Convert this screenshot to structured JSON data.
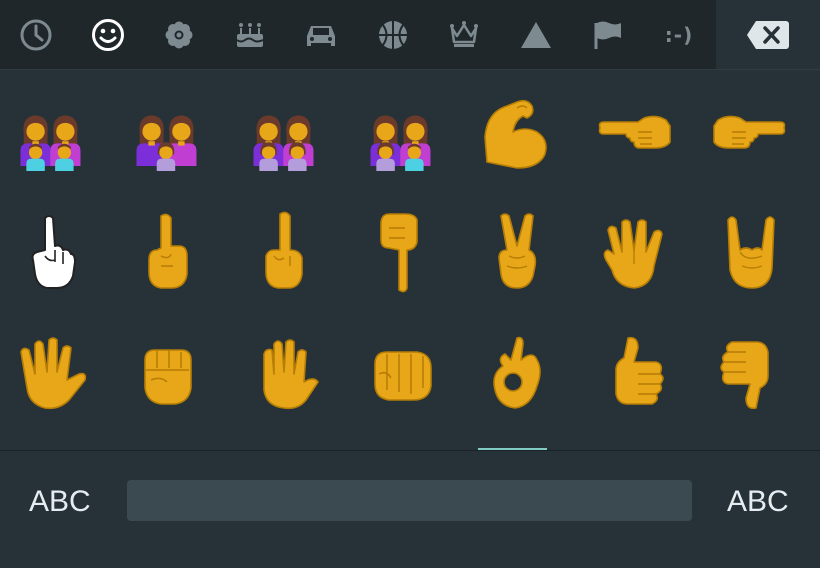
{
  "emoji_tabs": [
    {
      "icon": "clock-icon",
      "active": false
    },
    {
      "icon": "smiley-icon",
      "active": true
    },
    {
      "icon": "flower-icon",
      "active": false
    },
    {
      "icon": "cake-icon",
      "active": false
    },
    {
      "icon": "car-icon",
      "active": false
    },
    {
      "icon": "basketball-icon",
      "active": false
    },
    {
      "icon": "crown-icon",
      "active": false
    },
    {
      "icon": "triangle-icon",
      "active": false
    },
    {
      "icon": "flag-icon",
      "active": false
    },
    {
      "icon": "emoticon-tab",
      "label": ":-)",
      "active": false
    }
  ],
  "delete_key": {
    "icon": "backspace-icon"
  },
  "emoji_grid": [
    [
      "family-two-women-two-boys-icon",
      "family-two-women-girl-icon",
      "family-two-women-two-girls-icon",
      "family-two-women-girl-boy-icon",
      "flexed-biceps-icon",
      "pointing-left-icon",
      "pointing-right-icon"
    ],
    [
      "pointing-up-white-icon",
      "index-pointing-up-icon",
      "middle-finger-icon",
      "index-pointing-down-icon",
      "victory-hand-icon",
      "vulcan-salute-icon",
      "sign-of-horns-icon"
    ],
    [
      "splayed-hand-icon",
      "raised-fist-icon",
      "raised-hand-icon",
      "oncoming-fist-icon",
      "ok-hand-icon",
      "thumbs-up-icon",
      "thumbs-down-icon"
    ]
  ],
  "bottom_bar": {
    "left_label": "ABC",
    "right_label": "ABC"
  },
  "colors": {
    "background": "#263238",
    "tab_bar": "#1f272b",
    "tab_icon": "#7d8a90",
    "active_tab_icon": "#ffffff",
    "indicator": "#80cbc4",
    "emoji_skin": "#e8a719",
    "emoji_outline": "#b57d05",
    "hair": "#6b3a2a",
    "shirt_purple": "#7c2fd8",
    "shirt_magenta": "#c13ed3",
    "spacebar": "#3b4a51"
  }
}
